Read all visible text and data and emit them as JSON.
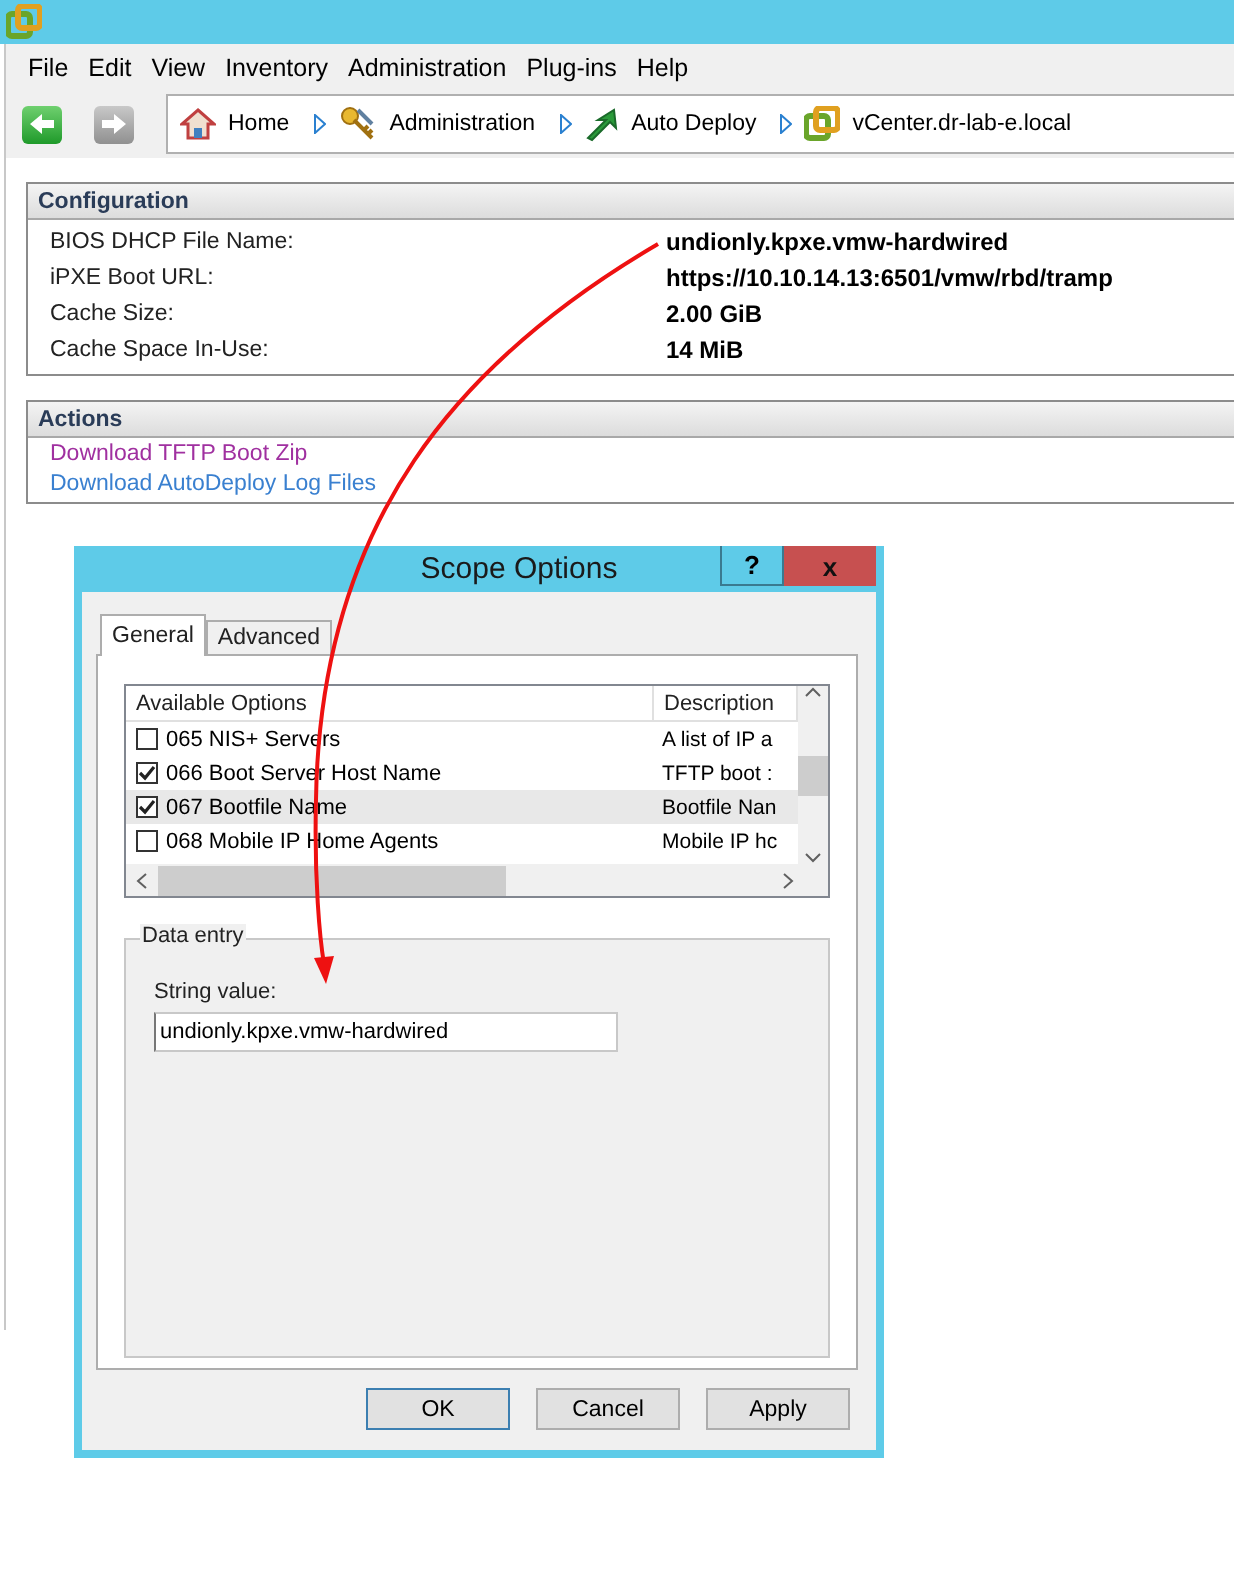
{
  "menu": [
    {
      "label": "File"
    },
    {
      "label": "Edit"
    },
    {
      "label": "View"
    },
    {
      "label": "Inventory"
    },
    {
      "label": "Administration"
    },
    {
      "label": "Plug-ins"
    },
    {
      "label": "Help"
    }
  ],
  "navigation": {
    "back": {
      "disabled": false
    },
    "forward": {
      "disabled": true
    },
    "breadcrumb": [
      {
        "label": "Home",
        "kind": "home"
      },
      {
        "label": "Administration",
        "kind": "admin"
      },
      {
        "label": "Auto Deploy",
        "kind": "deploy"
      },
      {
        "label": "vCenter.dr-lab-e.local",
        "kind": "vcenter"
      }
    ]
  },
  "configuration": {
    "title": "Configuration",
    "rows": [
      {
        "label": "BIOS DHCP File Name:",
        "value": "undionly.kpxe.vmw-hardwired"
      },
      {
        "label": "iPXE Boot URL:",
        "value": "https://10.10.14.13:6501/vmw/rbd/tramp"
      },
      {
        "label": "Cache Size:",
        "value": "2.00 GiB"
      },
      {
        "label": "Cache Space In-Use:",
        "value": "14 MiB"
      }
    ]
  },
  "actions": {
    "title": "Actions",
    "links": [
      {
        "label": "Download TFTP Boot Zip",
        "visited": true
      },
      {
        "label": "Download AutoDeploy Log Files",
        "visited": false
      }
    ]
  },
  "dialog": {
    "title": "Scope Options",
    "help": "?",
    "close": "x",
    "tabs": [
      {
        "label": "General",
        "selected": true
      },
      {
        "label": "Advanced",
        "selected": false
      }
    ],
    "list": {
      "columns": [
        "Available Options",
        "Description"
      ],
      "rows": [
        {
          "option": "065 NIS+ Servers",
          "description": "A list of IP a",
          "checked": false,
          "selected": false
        },
        {
          "option": "066 Boot Server Host Name",
          "description": "TFTP boot :",
          "checked": true,
          "selected": false
        },
        {
          "option": "067 Bootfile Name",
          "description": "Bootfile Nan",
          "checked": true,
          "selected": true
        },
        {
          "option": "068 Mobile IP Home Agents",
          "description": "Mobile IP hc",
          "checked": false,
          "selected": false
        }
      ]
    },
    "data_entry": {
      "title": "Data entry",
      "field_label": "String value:",
      "value": "undionly.kpxe.vmw-hardwired"
    },
    "buttons": [
      {
        "label": "OK",
        "default": true
      },
      {
        "label": "Cancel",
        "default": false
      },
      {
        "label": "Apply",
        "default": false
      }
    ]
  }
}
